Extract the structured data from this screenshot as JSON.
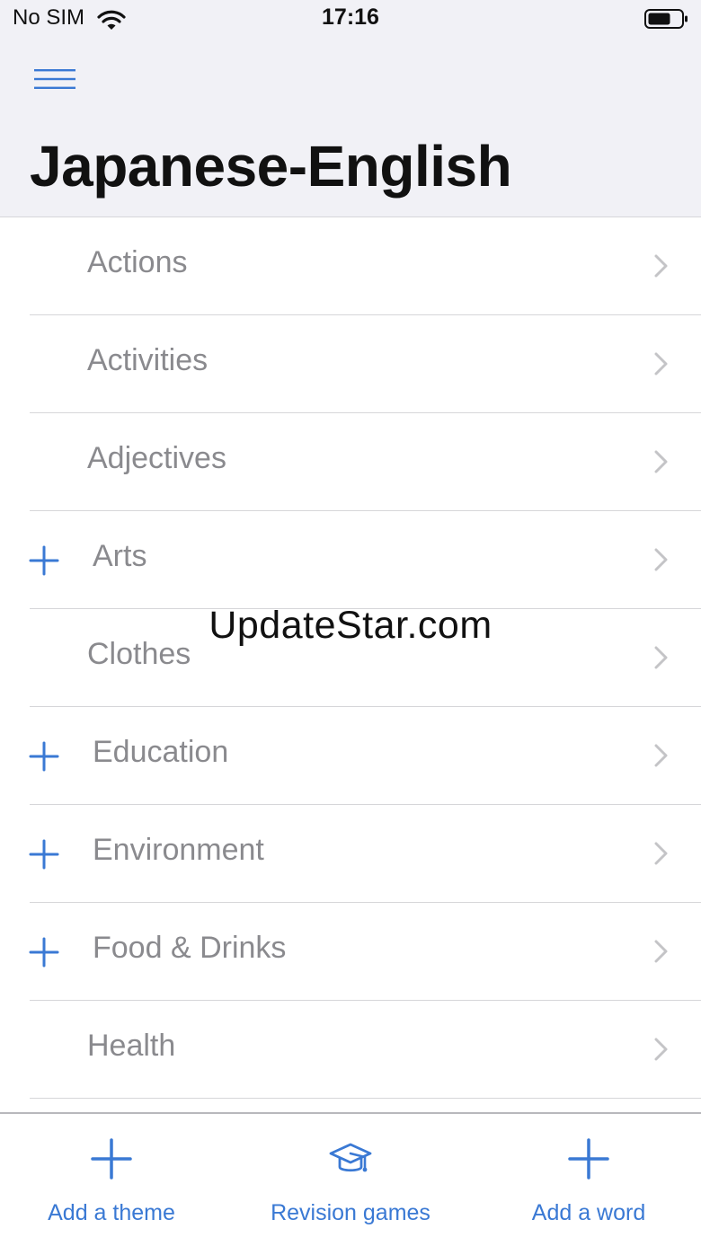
{
  "status_bar": {
    "carrier": "No SIM",
    "time": "17:16"
  },
  "header": {
    "title": "Japanese-English",
    "menu_icon": "hamburger-menu-icon"
  },
  "list": {
    "items": [
      {
        "label": "Actions",
        "expandable": false
      },
      {
        "label": "Activities",
        "expandable": false
      },
      {
        "label": "Adjectives",
        "expandable": false
      },
      {
        "label": "Arts",
        "expandable": true
      },
      {
        "label": "Clothes",
        "expandable": false
      },
      {
        "label": "Education",
        "expandable": true
      },
      {
        "label": "Environment",
        "expandable": true
      },
      {
        "label": "Food & Drinks",
        "expandable": true
      },
      {
        "label": "Health",
        "expandable": false
      }
    ]
  },
  "watermark": "UpdateStar.com",
  "toolbar": {
    "add_theme_label": "Add a theme",
    "revision_games_label": "Revision games",
    "add_word_label": "Add a word"
  },
  "colors": {
    "accent": "#3a79d4",
    "header_bg": "#f1f1f6",
    "item_text": "#8a8a8e",
    "separator": "#d6d6d9"
  }
}
